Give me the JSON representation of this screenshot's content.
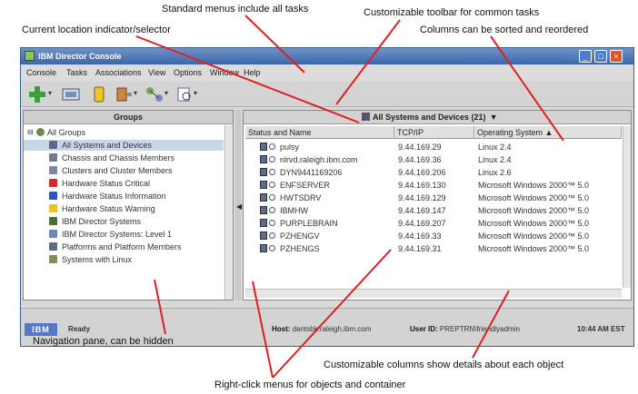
{
  "callouts": {
    "menus": "Standard menus include all tasks",
    "toolbar": "Customizable toolbar for common tasks",
    "location": "Current location indicator/selector",
    "columns": "Columns can be sorted and reordered",
    "navigation": "Navigation pane, can be hidden",
    "custom_columns": "Customizable columns show details about each object",
    "right_click": "Right-click menus for objects and container"
  },
  "window": {
    "title": "IBM Director Console",
    "menus": [
      "Console",
      "Tasks",
      "Associations",
      "View",
      "Options",
      "Window",
      "Help"
    ]
  },
  "navigation": {
    "header": "Groups",
    "root": "All Groups",
    "items": [
      {
        "label": "All Systems and Devices",
        "icon": "systems-icon"
      },
      {
        "label": "Chassis and Chassis Members",
        "icon": "chassis-icon"
      },
      {
        "label": "Clusters and Cluster Members",
        "icon": "cluster-icon"
      },
      {
        "label": "Hardware Status Critical",
        "icon": "critical-icon"
      },
      {
        "label": "Hardware Status Information",
        "icon": "info-icon"
      },
      {
        "label": "Hardware Status Warning",
        "icon": "warning-icon"
      },
      {
        "label": "IBM Director Systems",
        "icon": "director-icon"
      },
      {
        "label": "IBM Director Systems: Level 1",
        "icon": "level-icon"
      },
      {
        "label": "Platforms and Platform Members",
        "icon": "platform-icon"
      },
      {
        "label": "Systems with Linux",
        "icon": "linux-icon"
      }
    ]
  },
  "content": {
    "selector": "All Systems and Devices (21)",
    "columns": [
      "Status and Name",
      "TCP/IP",
      "Operating System ▲"
    ],
    "rows": [
      {
        "name": "pulsy",
        "ip": "9.44.169.29",
        "os": "Linux 2.4"
      },
      {
        "name": "nlrvd.raleigh.ibm.com",
        "ip": "9.44.169.36",
        "os": "Linux 2.4"
      },
      {
        "name": "DYN9441169206",
        "ip": "9.44.169.206",
        "os": "Linux 2.6"
      },
      {
        "name": "ENFSERVER",
        "ip": "9.44.169.130",
        "os": "Microsoft Windows 2000™ 5.0"
      },
      {
        "name": "HWTSDRV",
        "ip": "9.44.169.129",
        "os": "Microsoft Windows 2000™ 5.0"
      },
      {
        "name": "IBMHW",
        "ip": "9.44.169.147",
        "os": "Microsoft Windows 2000™ 5.0"
      },
      {
        "name": "PURPLEBRAIN",
        "ip": "9.44.169.207",
        "os": "Microsoft Windows 2000™ 5.0"
      },
      {
        "name": "PZHENGV",
        "ip": "9.44.169.33",
        "os": "Microsoft Windows 2000™ 5.0"
      },
      {
        "name": "PZHENGS",
        "ip": "9.44.169.31",
        "os": "Microsoft Windows 2000™ 5.0"
      }
    ]
  },
  "status": {
    "logo": "IBM",
    "state": "Ready",
    "host_label": "Host:",
    "host_value": "dantsbk.raleigh.ibm.com",
    "user_label": "User ID:",
    "user_value": "PREPTRN\\friendlyadmin",
    "time": "10:44 AM EST"
  },
  "colors": {
    "titlebar": "#3c66a9",
    "accent": "#5577c4"
  }
}
